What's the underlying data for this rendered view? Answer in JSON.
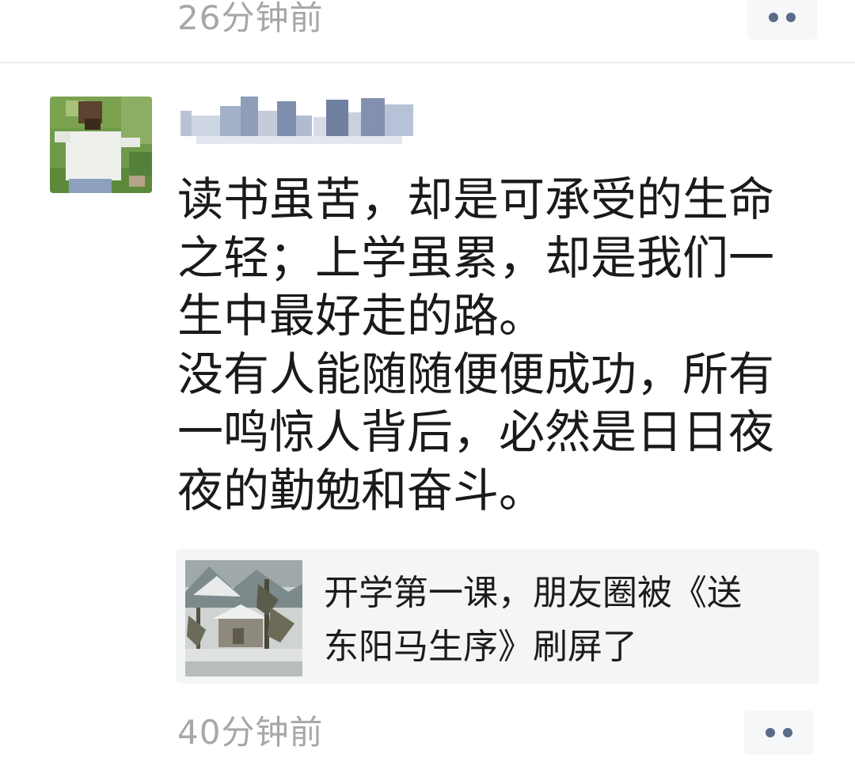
{
  "prev_post": {
    "timestamp": "26分钟前",
    "more_icon": "more-dots-icon"
  },
  "post": {
    "avatar_icon": "avatar-photo",
    "username_icon": "blurred-username",
    "text": "读书虽苦，却是可承受的生命\n之轻；上学虽累，却是我们一\n生中最好走的路。\n没有人能随随便便成功，所有\n一鸣惊人背后，必然是日日夜\n夜的勤勉和奋斗。",
    "link": {
      "thumbnail_icon": "snowy-landscape-painting",
      "title": "开学第一课，朋友圈被《送\n东阳马生序》刷屏了"
    },
    "timestamp": "40分钟前",
    "more_icon": "more-dots-icon"
  },
  "colors": {
    "timestamp": "#a7a7a7",
    "more_button_bg": "#f6f7f9",
    "more_dots": "#5a6b8a",
    "link_card_bg": "#f4f5f7",
    "body_text": "#1a1a1a"
  }
}
